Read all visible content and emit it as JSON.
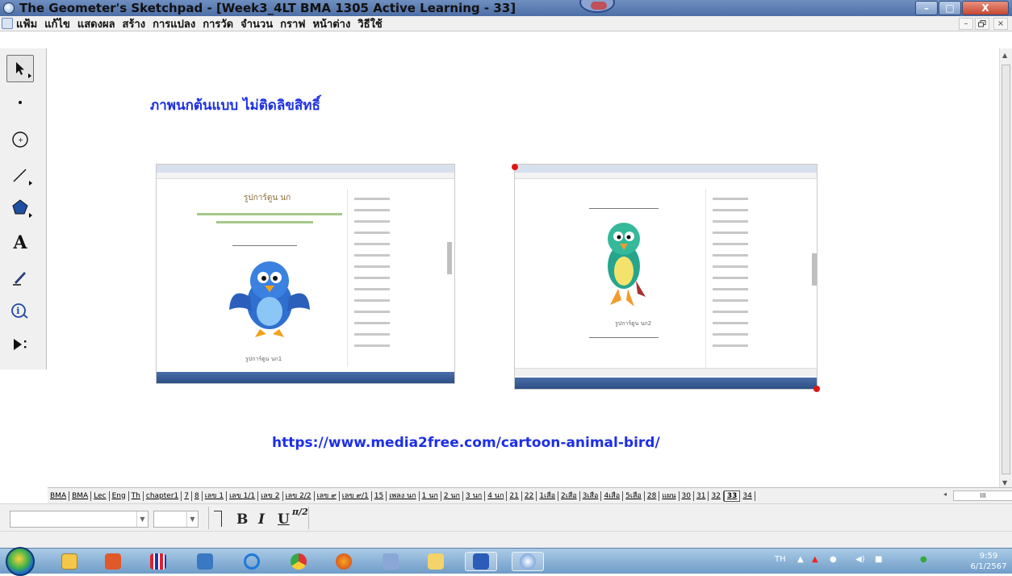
{
  "window": {
    "title": "The Geometer's Sketchpad - [Week3_4LT BMA 1305 Active Learning - 33]",
    "min_symbol": "–",
    "max_symbol": "□",
    "close_symbol": "X"
  },
  "menu": {
    "items": [
      "แฟ้ม",
      "แก้ไข",
      "แสดงผล",
      "สร้าง",
      "การแปลง",
      "การวัด",
      "จำนวน",
      "กราฟ",
      "หน้าต่าง",
      "วิธีใช้"
    ],
    "mdi_min": "–",
    "mdi_restore": "รี",
    "mdi_close": "×"
  },
  "toolbox": {
    "tools": [
      "arrow-select-tool",
      "point-tool",
      "compass-tool",
      "straightedge-tool",
      "polygon-tool",
      "text-tool",
      "marker-tool",
      "information-tool",
      "custom-tool"
    ],
    "text_tool_glyph": "A"
  },
  "canvas": {
    "heading": "ภาพนกต้นแบบ    ไม่ติดลิขสิทธิ์",
    "url": "https://www.media2free.com/cartoon-animal-bird/",
    "left_shot": {
      "page_title": "รูปการ์ตูน นก",
      "caption": "รูปการ์ตูน นก1",
      "bird_color": "#2f6fd0"
    },
    "right_shot": {
      "caption": "รูปการ์ตูน นก2",
      "bird_color": "#27a58c"
    },
    "accent": "#1c2fe6"
  },
  "tabs": {
    "items": [
      "BMA",
      "BMA",
      "Lec",
      "Eng",
      "Th",
      "chapter1",
      "7",
      "8",
      "เลข 1",
      "เลข 1/1",
      "เลข 2",
      "เลข 2/2",
      "เลข ๙",
      "เลข ๙/1",
      "15",
      "เพลง นก",
      "1 นก",
      "2 นก",
      "3 นก",
      "4 นก",
      "21",
      "22",
      "1เสือ",
      "2เสือ",
      "3เสือ",
      "4เสือ",
      "5เสือ",
      "28",
      "แผน",
      "30",
      "31",
      "32",
      "33",
      "34"
    ],
    "active": "33",
    "scroll_left": "◂",
    "scroll_grip": "III",
    "scroll_right": "▸"
  },
  "textbar": {
    "bold": "B",
    "italic": "I",
    "underline": "U",
    "math": "π/2"
  },
  "taskbar": {
    "apps": [
      "explorer-icon",
      "office-icon",
      "grid-app-icon",
      "computer-icon",
      "ie-icon",
      "chrome-icon",
      "firefox-icon",
      "keyboard-icon",
      "folder-icon",
      "word-icon",
      "sketchpad-icon"
    ],
    "lang": "TH",
    "time": "9:59",
    "date": "6/1/2567"
  }
}
